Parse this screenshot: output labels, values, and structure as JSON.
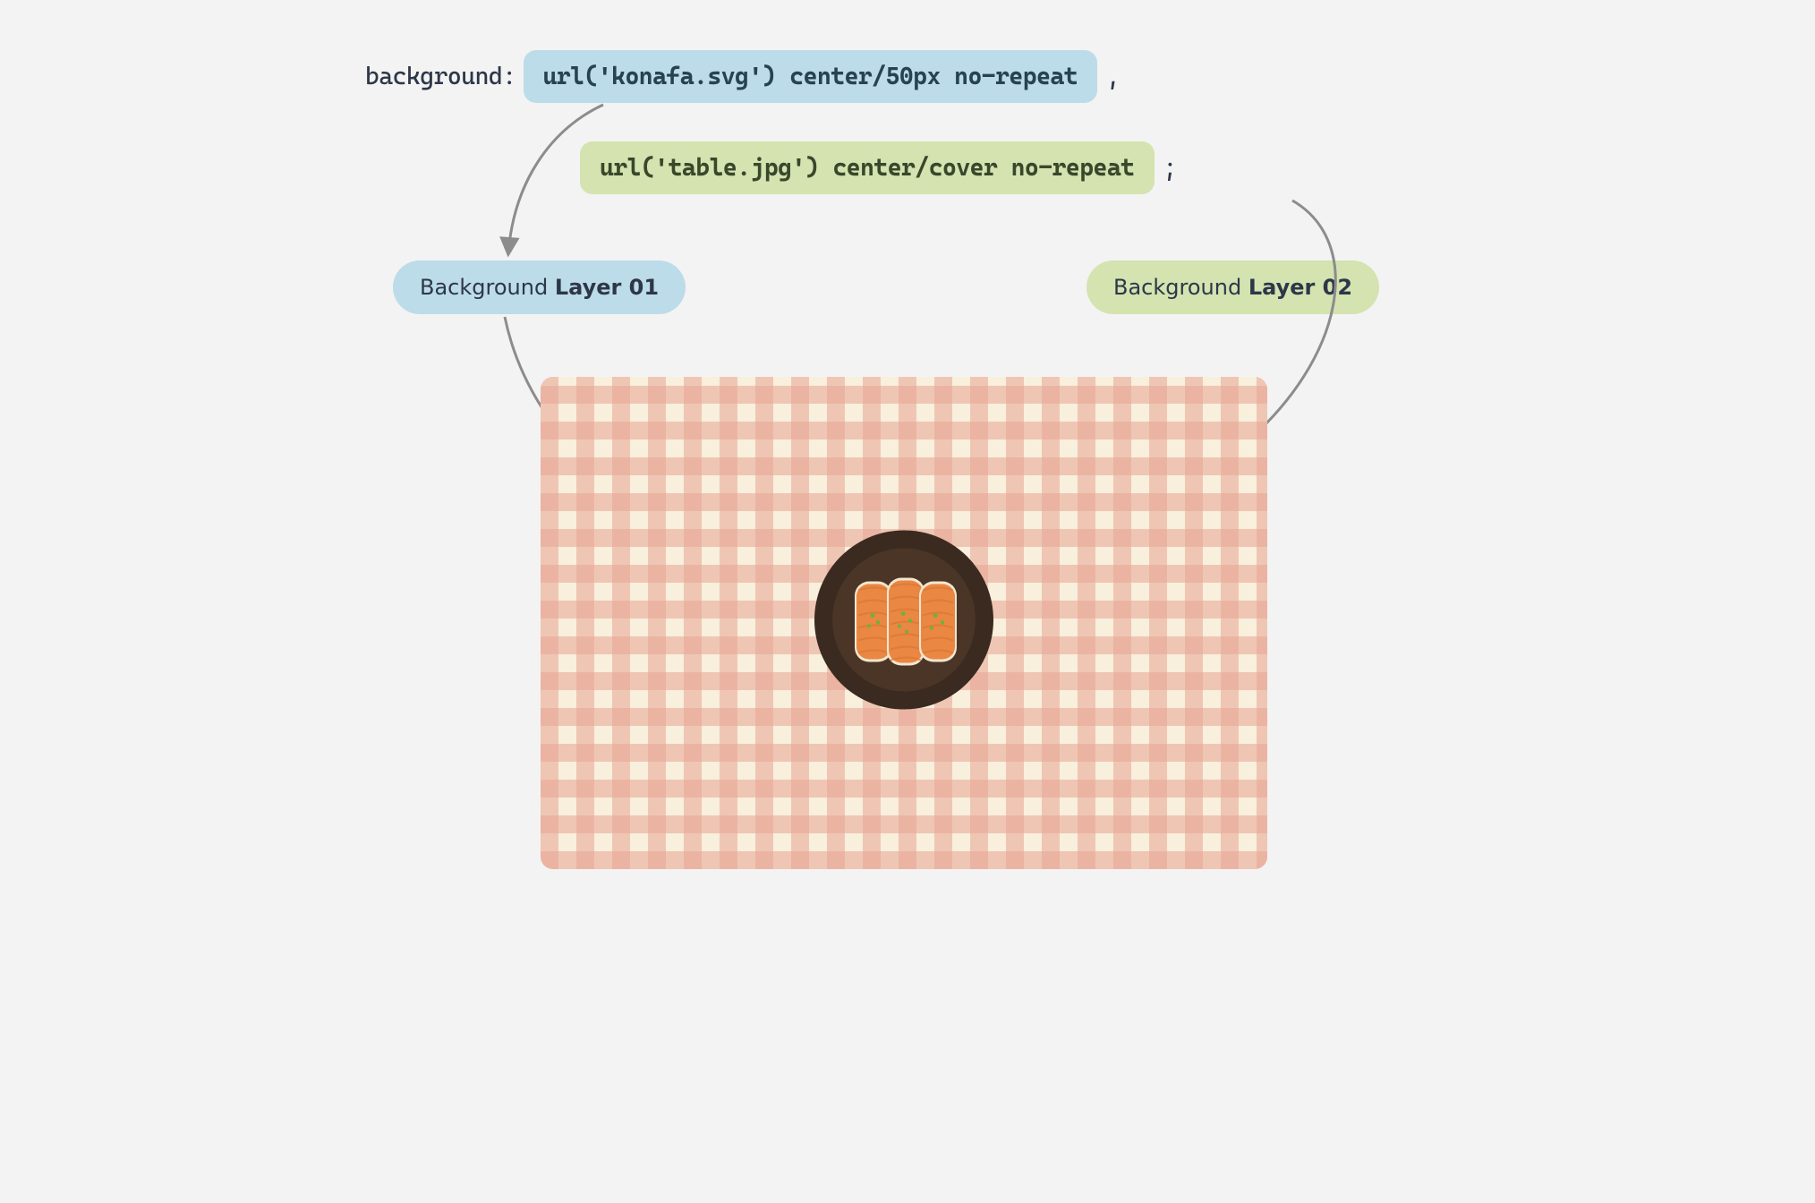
{
  "code": {
    "property": "background:",
    "layer1": "url('konafa.svg') center/50px no-repeat",
    "comma": ",",
    "layer2": "url('table.jpg') center/cover no-repeat",
    "semicolon": ";"
  },
  "labels": {
    "layer1_prefix": "Background ",
    "layer1_bold": "Layer 01",
    "layer2_prefix": "Background ",
    "layer2_bold": "Layer 02"
  },
  "colors": {
    "blue": "#bcdce9",
    "green": "#d4e3b0",
    "arrow": "#8c8c8c",
    "plate_outer": "#3b2a20",
    "plate_inner": "#4a3527",
    "konafa": "#e98743",
    "konafa_dark": "#d97731",
    "pistachio": "#6bb23e",
    "cloth_bg": "#f8efdc",
    "cloth_stripe": "#eec1b3"
  }
}
